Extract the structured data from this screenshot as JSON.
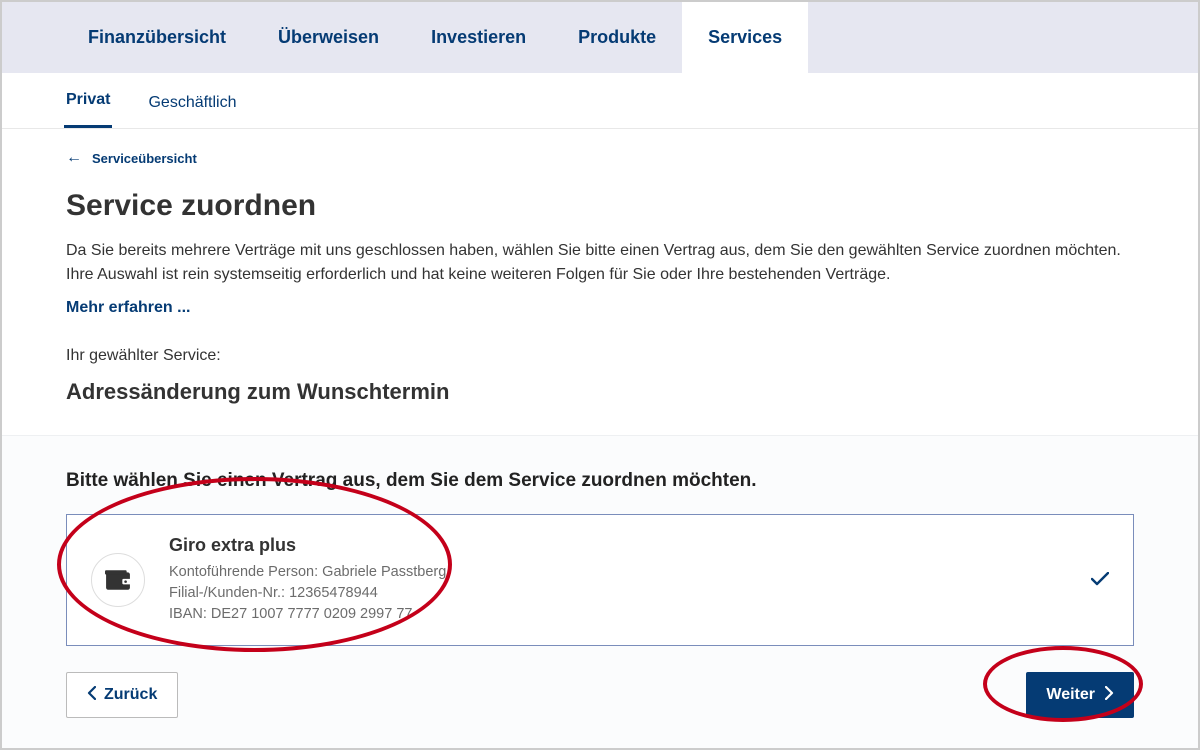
{
  "topnav": {
    "items": [
      {
        "label": "Finanzübersicht"
      },
      {
        "label": "Überweisen"
      },
      {
        "label": "Investieren"
      },
      {
        "label": "Produkte"
      },
      {
        "label": "Services",
        "active": true
      }
    ]
  },
  "subnav": {
    "tabs": [
      {
        "label": "Privat",
        "active": true
      },
      {
        "label": "Geschäftlich"
      }
    ]
  },
  "back_link": {
    "label": "Serviceübersicht"
  },
  "page_title": "Service zuordnen",
  "intro_text": "Da Sie bereits mehrere Verträge mit uns geschlossen haben, wählen Sie bitte einen Vertrag aus, dem Sie den gewählten Service zuordnen möchten. Ihre Auswahl ist rein systemseitig erforderlich und hat keine weiteren Folgen für Sie oder Ihre bestehenden Verträge.",
  "more_link": "Mehr erfahren ...",
  "selected_label": "Ihr gewählter Service:",
  "selected_service": "Adressänderung zum Wunschtermin",
  "select_heading": "Bitte wählen Sie einen Vertrag aus, dem Sie dem Service zuordnen möchten.",
  "contract": {
    "name": "Giro extra plus",
    "line_holder": "Kontoführende Person: Gabriele Passtberg",
    "line_customer": "Filial-/Kunden-Nr.: 12365478944",
    "line_iban": "IBAN: DE27 1007 7777 0209 2997 77",
    "selected": true
  },
  "buttons": {
    "back": "Zurück",
    "next": "Weiter"
  }
}
